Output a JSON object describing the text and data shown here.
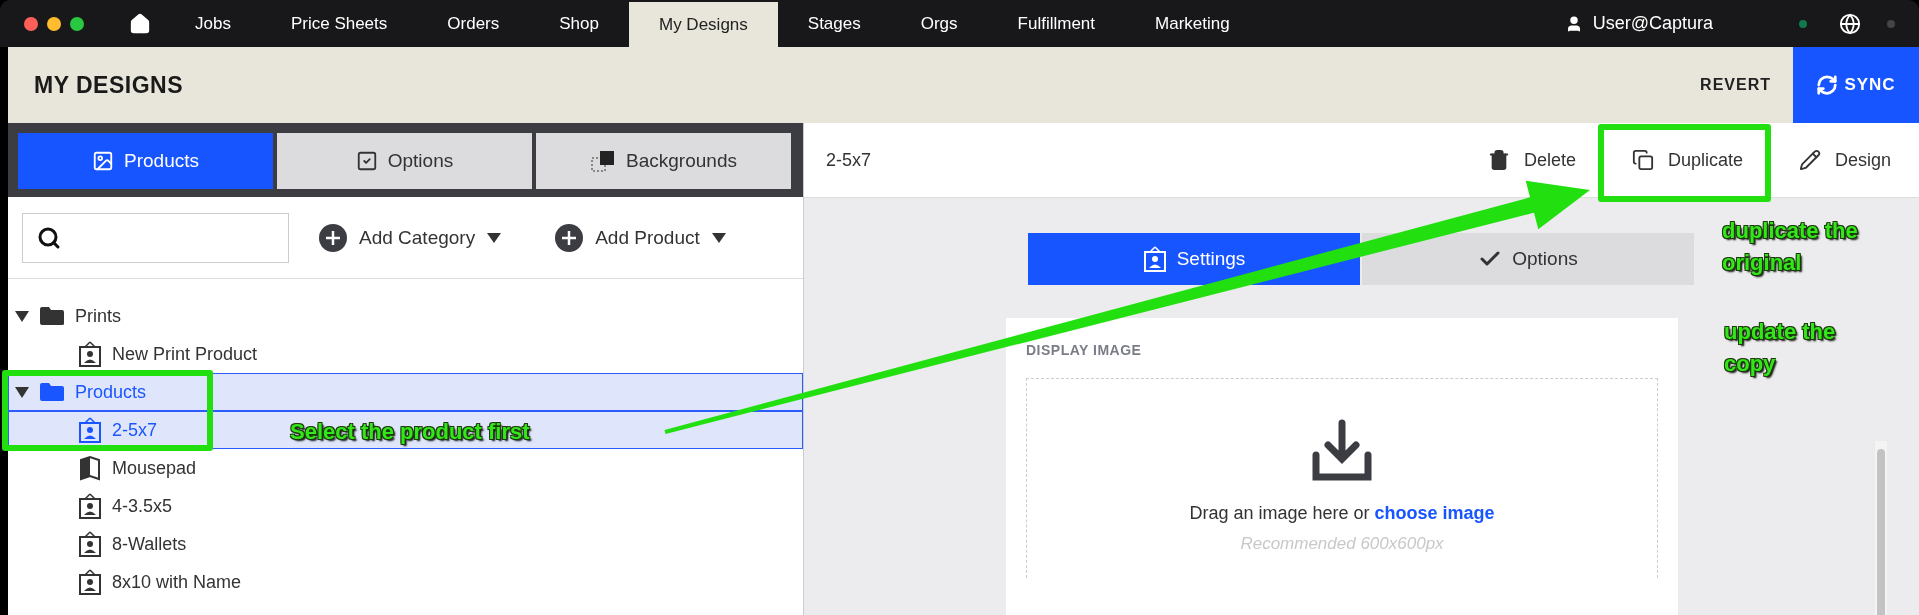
{
  "nav": {
    "tabs": [
      {
        "label": "Jobs",
        "selected": false
      },
      {
        "label": "Price Sheets",
        "selected": false
      },
      {
        "label": "Orders",
        "selected": false
      },
      {
        "label": "Shop",
        "selected": false
      },
      {
        "label": "My Designs",
        "selected": true
      },
      {
        "label": "Stages",
        "selected": false
      },
      {
        "label": "Orgs",
        "selected": false
      },
      {
        "label": "Fulfillment",
        "selected": false
      },
      {
        "label": "Marketing",
        "selected": false
      }
    ],
    "user": "User@Captura"
  },
  "header": {
    "title": "MY DESIGNS",
    "revert": "REVERT",
    "sync": "SYNC"
  },
  "left_tabs": [
    {
      "label": "Products",
      "kind": "image",
      "selected": true
    },
    {
      "label": "Options",
      "kind": "check",
      "selected": false
    },
    {
      "label": "Backgrounds",
      "kind": "layers",
      "selected": false
    }
  ],
  "add_buttons": [
    "Add Category",
    "Add Product"
  ],
  "tree": [
    {
      "label": "Prints",
      "expanded": true,
      "selected": false,
      "children": [
        {
          "label": "New Print Product",
          "kind": "portrait",
          "selected": false
        }
      ]
    },
    {
      "label": "Products",
      "expanded": true,
      "selected": true,
      "children": [
        {
          "label": "2-5x7",
          "kind": "portrait",
          "selected": true
        },
        {
          "label": "Mousepad",
          "kind": "mousepad",
          "selected": false
        },
        {
          "label": "4-3.5x5",
          "kind": "portrait",
          "selected": false
        },
        {
          "label": "8-Wallets",
          "kind": "portrait",
          "selected": false
        },
        {
          "label": "8x10 with Name",
          "kind": "portrait",
          "selected": false
        }
      ]
    }
  ],
  "detail": {
    "title": "2-5x7",
    "actions": [
      {
        "label": "Delete",
        "kind": "delete"
      },
      {
        "label": "Duplicate",
        "kind": "duplicate"
      },
      {
        "label": "Design",
        "kind": "design"
      }
    ],
    "tabs": [
      {
        "label": "Settings",
        "kind": "portrait",
        "selected": true
      },
      {
        "label": "Options",
        "kind": "check",
        "selected": false
      }
    ],
    "section": "DISPLAY IMAGE",
    "drop_text": "Drag an image here or",
    "drop_link": "choose image",
    "drop_hint": "Recommended 600x600px"
  },
  "annotations": [
    "Select the product first",
    "duplicate the  original",
    "update the copy"
  ]
}
